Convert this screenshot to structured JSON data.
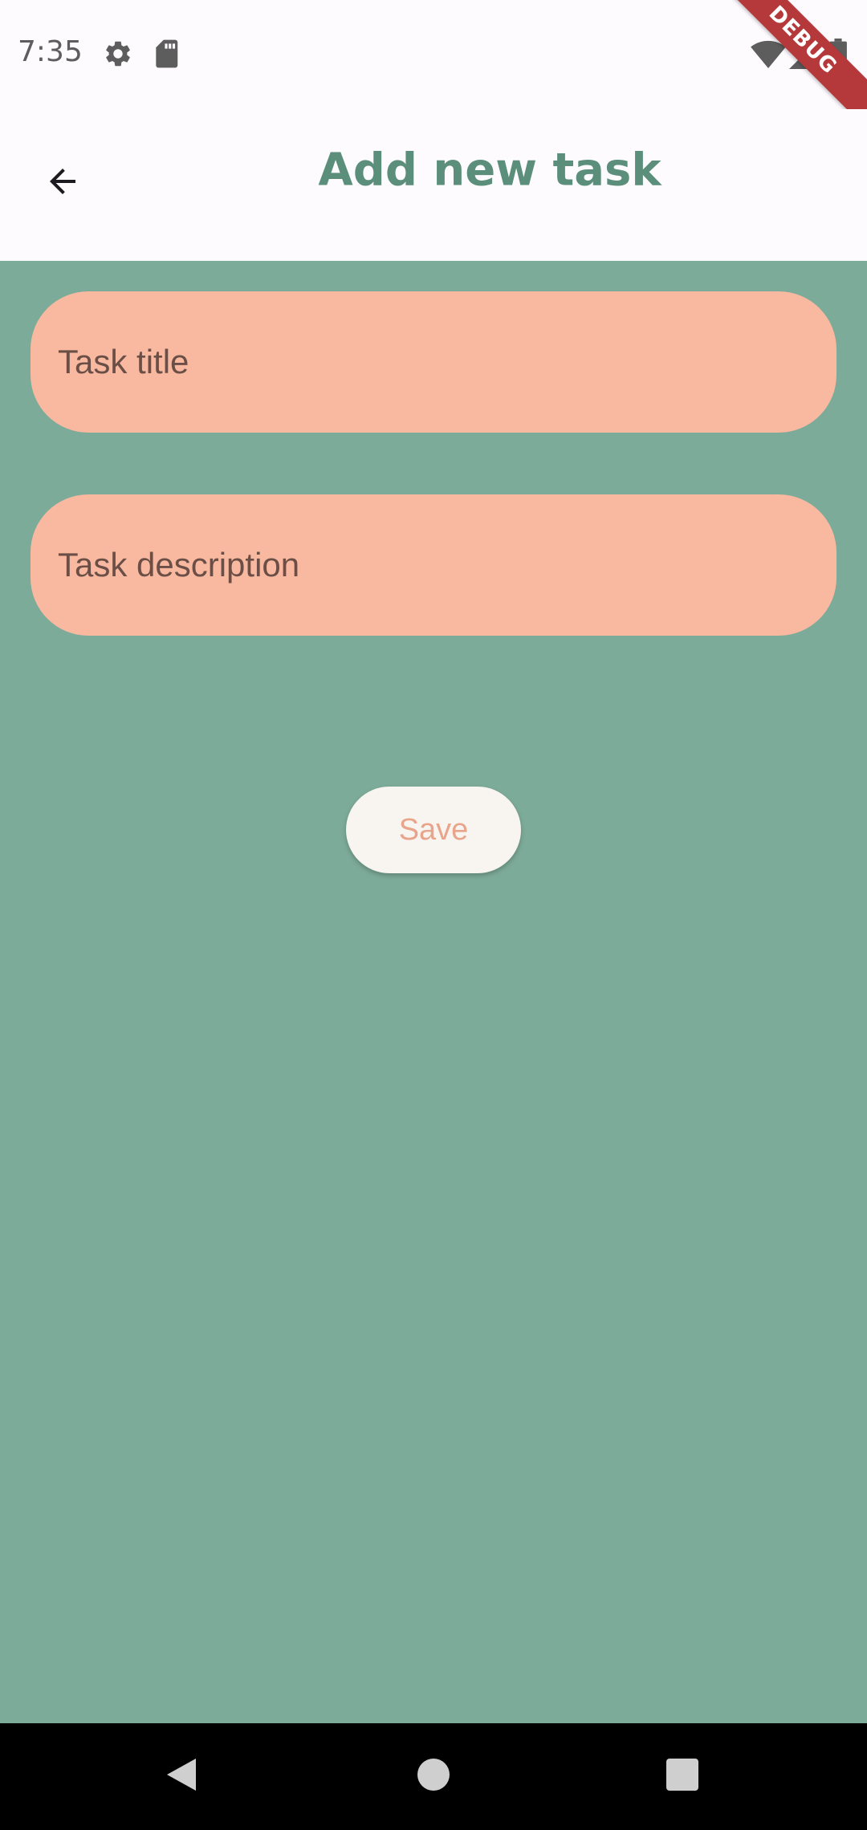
{
  "status_bar": {
    "time": "7:35",
    "icons": [
      "settings-icon",
      "sd-card-icon",
      "wifi-icon",
      "signal-icon",
      "battery-icon"
    ]
  },
  "debug_banner": {
    "label": "DEBUG"
  },
  "app_bar": {
    "title": "Add new task",
    "back_icon": "arrow-back-icon"
  },
  "form": {
    "title_placeholder": "Task title",
    "title_value": "",
    "description_placeholder": "Task description",
    "description_value": "",
    "save_label": "Save"
  },
  "nav_bar": {
    "icons": [
      "back-triangle-icon",
      "home-circle-icon",
      "recents-square-icon"
    ]
  },
  "colors": {
    "background": "#7DAB99",
    "app_bar": "#FEFBFE",
    "title_text": "#5B8F7B",
    "field_fill": "#F8B9A0",
    "button_fill": "#F8F4F0",
    "button_text": "#E9A58C",
    "debug_ribbon": "#B5393A"
  }
}
